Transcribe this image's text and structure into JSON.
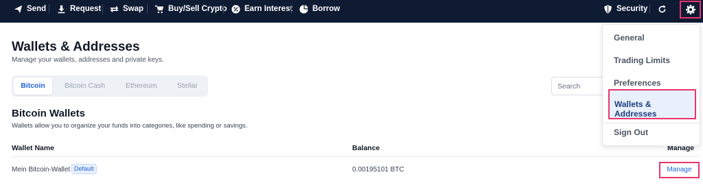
{
  "nav": {
    "send": "Send",
    "request": "Request",
    "swap": "Swap",
    "buy_sell": "Buy/Sell Crypto",
    "earn": "Earn Interest",
    "borrow": "Borrow",
    "security": "Security"
  },
  "header": {
    "title": "Wallets & Addresses",
    "subtitle": "Manage your wallets, addresses and private keys."
  },
  "tabs": [
    "Bitcoin",
    "Bitcoin Cash",
    "Ethereum",
    "Stellar"
  ],
  "search": {
    "placeholder": "Search"
  },
  "section": {
    "title": "Bitcoin Wallets",
    "description": "Wallets allow you to organize your funds into categories, like spending or savings."
  },
  "table": {
    "headers": {
      "name": "Wallet Name",
      "balance": "Balance",
      "manage": "Manage"
    },
    "rows": [
      {
        "name": "Mein Bitcoin-Wallet",
        "badge": "Default",
        "balance": "0.00195101 BTC",
        "action": "Manage"
      }
    ]
  },
  "dropdown": {
    "items": [
      "General",
      "Trading Limits",
      "Preferences",
      "Wallets & Addresses",
      "Sign Out"
    ],
    "active": "Wallets & Addresses"
  },
  "colors": {
    "topbar": "#0e1b33",
    "accent": "#1d64d8",
    "highlight": "#e8356b"
  }
}
